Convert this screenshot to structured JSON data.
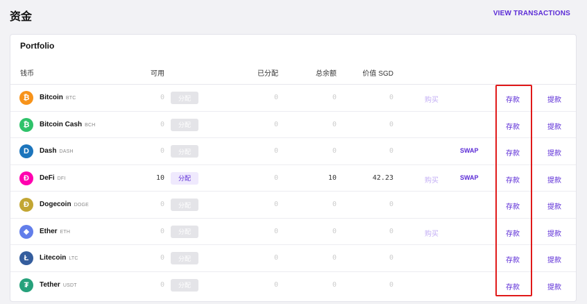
{
  "page": {
    "title": "资金",
    "view_transactions": "VIEW TRANSACTIONS"
  },
  "portfolio": {
    "title": "Portfolio",
    "headers": {
      "coin": "钱币",
      "available": "可用",
      "allocated": "已分配",
      "total": "总余额",
      "value": "价值 SGD"
    },
    "labels": {
      "allocate": "分配",
      "buy": "购买",
      "swap": "SWAP",
      "deposit": "存款",
      "withdraw": "提款"
    },
    "rows": [
      {
        "name": "Bitcoin",
        "symbol": "BTC",
        "available": "0",
        "allocated": "0",
        "total": "0",
        "value": "0",
        "color": "#f7931a",
        "icon": "bitcoin-icon",
        "glyph": "₿",
        "buy": "购买",
        "swap": ""
      },
      {
        "name": "Bitcoin Cash",
        "symbol": "BCH",
        "available": "0",
        "allocated": "0",
        "total": "0",
        "value": "0",
        "color": "#2fc26a",
        "icon": "bitcoin-cash-icon",
        "glyph": "₿",
        "buy": "",
        "swap": ""
      },
      {
        "name": "Dash",
        "symbol": "DASH",
        "available": "0",
        "allocated": "0",
        "total": "0",
        "value": "0",
        "color": "#1c75bc",
        "icon": "dash-icon",
        "glyph": "D",
        "buy": "",
        "swap": "SWAP"
      },
      {
        "name": "DeFi",
        "symbol": "DFI",
        "available": "10",
        "allocated": "0",
        "total": "10",
        "value": "42.23",
        "color": "#ff00af",
        "icon": "defi-icon",
        "glyph": "Ð",
        "buy": "购买",
        "swap": "SWAP",
        "active": true
      },
      {
        "name": "Dogecoin",
        "symbol": "DOGE",
        "available": "0",
        "allocated": "0",
        "total": "0",
        "value": "0",
        "color": "#c2a633",
        "icon": "dogecoin-icon",
        "glyph": "Ð",
        "buy": "",
        "swap": ""
      },
      {
        "name": "Ether",
        "symbol": "ETH",
        "available": "0",
        "allocated": "0",
        "total": "0",
        "value": "0",
        "color": "#627eea",
        "icon": "ether-icon",
        "glyph": "◆",
        "buy": "购买",
        "swap": ""
      },
      {
        "name": "Litecoin",
        "symbol": "LTC",
        "available": "0",
        "allocated": "0",
        "total": "0",
        "value": "0",
        "color": "#345d9d",
        "icon": "litecoin-icon",
        "glyph": "Ł",
        "buy": "",
        "swap": ""
      },
      {
        "name": "Tether",
        "symbol": "USDT",
        "available": "0",
        "allocated": "0",
        "total": "0",
        "value": "0",
        "color": "#26a17b",
        "icon": "tether-icon",
        "glyph": "₮",
        "buy": "",
        "swap": ""
      }
    ]
  }
}
